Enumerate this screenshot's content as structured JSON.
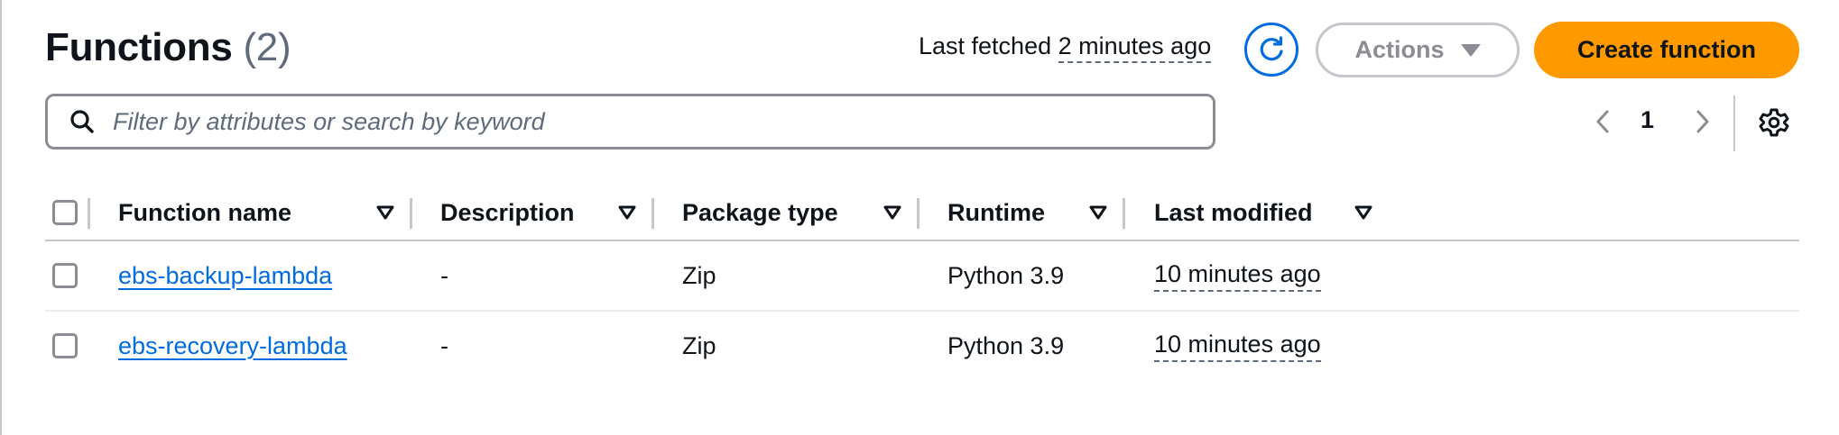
{
  "header": {
    "title": "Functions",
    "count": "(2)",
    "last_fetched_label": "Last fetched",
    "last_fetched_value": "2 minutes ago",
    "refresh_icon": "refresh-icon",
    "actions_label": "Actions",
    "create_label": "Create function"
  },
  "search": {
    "placeholder": "Filter by attributes or search by keyword",
    "value": ""
  },
  "pagination": {
    "current_page": "1",
    "prev_icon": "chevron-left-icon",
    "next_icon": "chevron-right-icon",
    "settings_icon": "gear-icon"
  },
  "table": {
    "columns": [
      "Function name",
      "Description",
      "Package type",
      "Runtime",
      "Last modified"
    ],
    "rows": [
      {
        "name": "ebs-backup-lambda",
        "description": "-",
        "package_type": "Zip",
        "runtime": "Python 3.9",
        "last_modified": "10 minutes ago"
      },
      {
        "name": "ebs-recovery-lambda",
        "description": "-",
        "package_type": "Zip",
        "runtime": "Python 3.9",
        "last_modified": "10 minutes ago"
      }
    ]
  },
  "colors": {
    "primary_orange": "#ff9900",
    "link_blue": "#006ce0",
    "border_grey": "#c6c6cd",
    "text_dark": "#0f141a"
  }
}
